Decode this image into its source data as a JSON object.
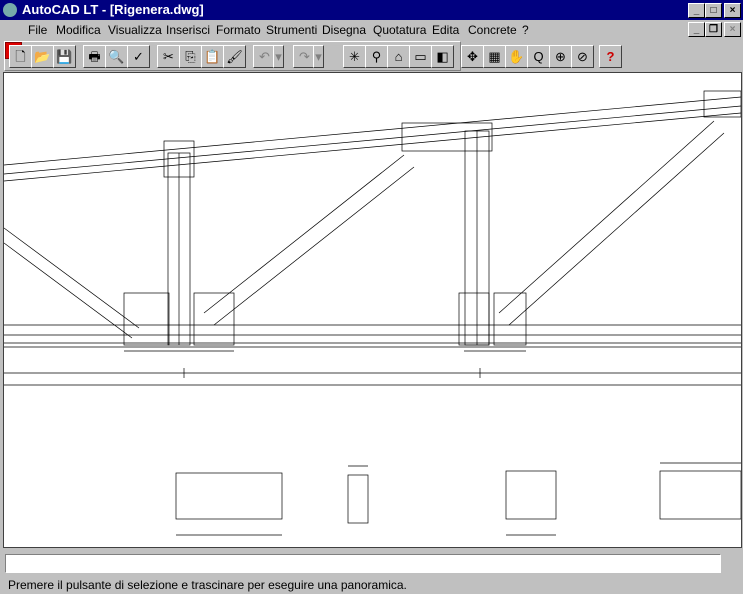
{
  "window": {
    "title": "AutoCAD LT - [Rigenera.dwg]",
    "buttons": [
      "minimize",
      "maximize",
      "close"
    ]
  },
  "menu": {
    "items": [
      "File",
      "Modifica",
      "Visualizza",
      "Inserisci",
      "Formato",
      "Strumenti",
      "Disegna",
      "Quotatura",
      "Edita",
      "Concrete",
      "?"
    ]
  },
  "toolbar": {
    "buttons": [
      {
        "name": "new-icon",
        "glyph": "🗋"
      },
      {
        "name": "open-icon",
        "glyph": "📂"
      },
      {
        "name": "save-icon",
        "glyph": "💾"
      },
      {
        "name": "print-icon",
        "glyph": "🖶"
      },
      {
        "name": "preview-icon",
        "glyph": "🔍"
      },
      {
        "name": "spellcheck-icon",
        "glyph": "✓"
      },
      {
        "name": "cut-icon",
        "glyph": "✂"
      },
      {
        "name": "copy-icon",
        "glyph": "⎘"
      },
      {
        "name": "paste-icon",
        "glyph": "📋"
      },
      {
        "name": "match-properties-icon",
        "glyph": "🖌"
      },
      {
        "name": "undo-icon",
        "glyph": "↶"
      },
      {
        "name": "undo-dropdown-icon",
        "glyph": "▾"
      },
      {
        "name": "redo-icon",
        "glyph": "↷"
      },
      {
        "name": "redo-dropdown-icon",
        "glyph": "▾"
      },
      {
        "name": "snap-icon",
        "glyph": "✳"
      },
      {
        "name": "tracking-icon",
        "glyph": "⚲"
      },
      {
        "name": "block-icon",
        "glyph": "⌂"
      },
      {
        "name": "dimension-icon",
        "glyph": "▭"
      },
      {
        "name": "layer-icon",
        "glyph": "◧"
      },
      {
        "name": "pan-realtime-icon",
        "glyph": "✥"
      },
      {
        "name": "aerial-view-icon",
        "glyph": "▦"
      },
      {
        "name": "pan-icon",
        "glyph": "✋"
      },
      {
        "name": "zoom-realtime-icon",
        "glyph": "Q"
      },
      {
        "name": "zoom-window-icon",
        "glyph": "⊕"
      },
      {
        "name": "zoom-previous-icon",
        "glyph": "⊘"
      },
      {
        "name": "help-icon",
        "glyph": "?"
      }
    ]
  },
  "command_line": {
    "value": ""
  },
  "status": {
    "text": "Premere il pulsante di selezione e trascinare per eseguire una panoramica."
  },
  "colors": {
    "title_bar": "#000080",
    "face": "#c0c0c0",
    "canvas": "#ffffff"
  }
}
